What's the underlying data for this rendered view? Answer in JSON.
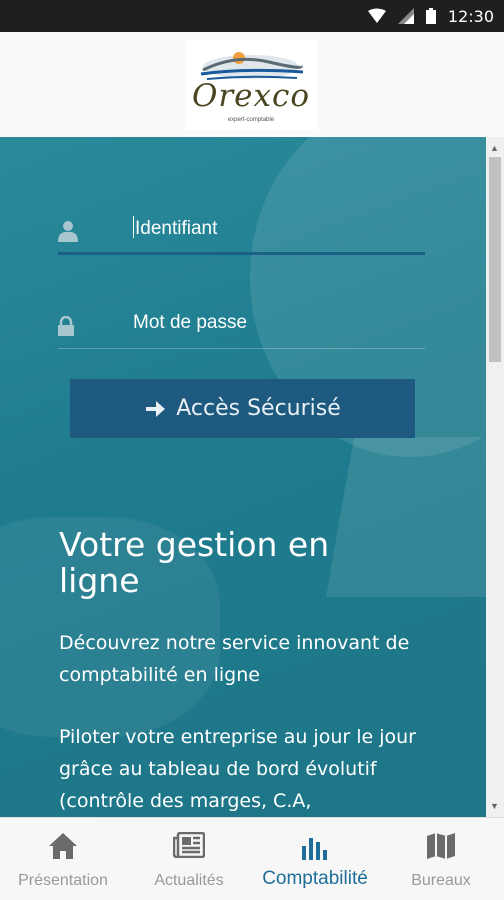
{
  "status_bar": {
    "time": "12:30"
  },
  "header": {
    "logo_word": "Orexco",
    "logo_subtitle": "expert-comptable"
  },
  "login": {
    "username_placeholder": "Identifiant",
    "password_placeholder": "Mot de passe",
    "submit_label": "Accès Sécurisé"
  },
  "content": {
    "headline": "Votre gestion en ligne",
    "paragraph1": "Découvrez notre service innovant de comptabilité en ligne",
    "paragraph2": "Piloter votre entreprise au jour le jour grâce au tableau de bord évolutif (contrôle des marges, C.A,"
  },
  "bottom_nav": {
    "items": [
      {
        "label": "Présentation",
        "icon": "home-icon"
      },
      {
        "label": "Actualités",
        "icon": "newspaper-icon"
      },
      {
        "label": "Comptabilité",
        "icon": "bar-chart-icon",
        "active": true
      },
      {
        "label": "Bureaux",
        "icon": "map-icon"
      }
    ]
  },
  "colors": {
    "accent": "#1f6e9a",
    "button_bg": "#1e5a80",
    "main_bg": "#1f7d8f",
    "nav_inactive": "#999999"
  }
}
